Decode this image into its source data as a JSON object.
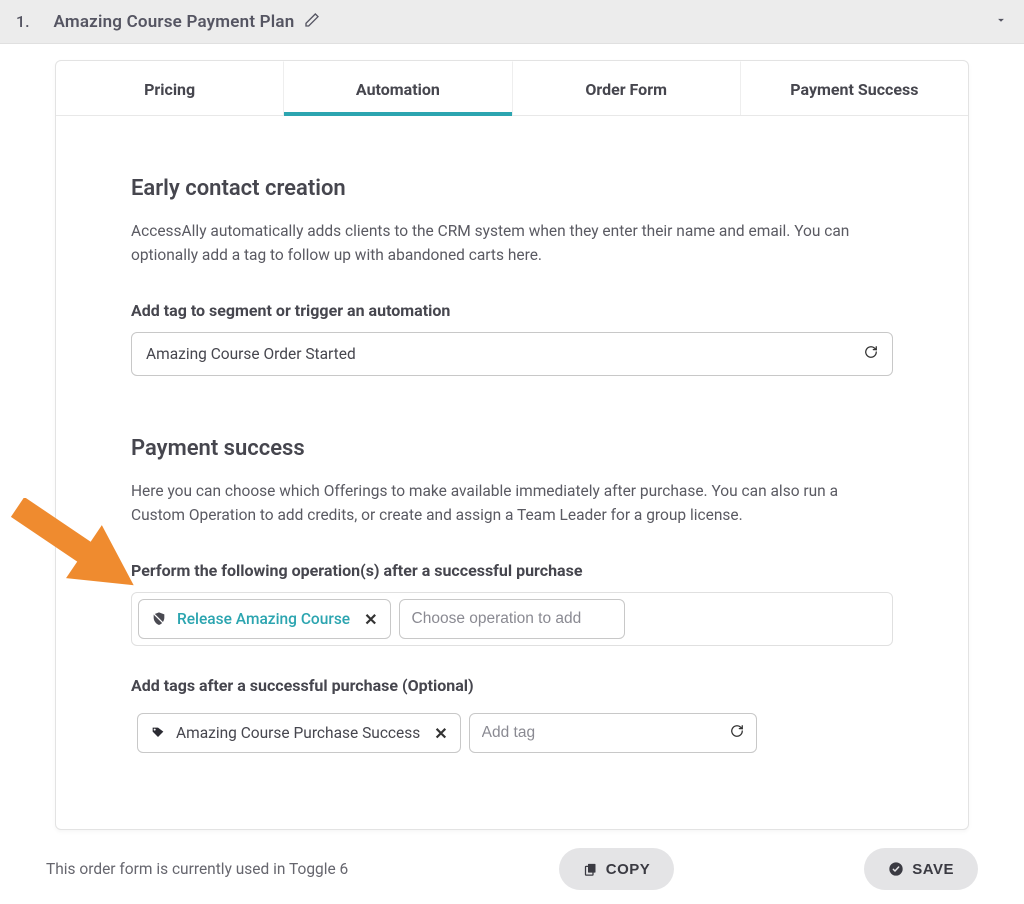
{
  "header": {
    "number": "1.",
    "title": "Amazing Course Payment Plan"
  },
  "tabs": [
    {
      "label": "Pricing",
      "active": false
    },
    {
      "label": "Automation",
      "active": true
    },
    {
      "label": "Order Form",
      "active": false
    },
    {
      "label": "Payment Success",
      "active": false
    }
  ],
  "early_contact": {
    "title": "Early contact creation",
    "desc": "AccessAlly automatically adds clients to the CRM system when they enter their name and email. You can optionally add a tag to follow up with abandoned carts here.",
    "tag_label": "Add tag to segment or trigger an automation",
    "tag_value": "Amazing Course Order Started"
  },
  "payment_success": {
    "title": "Payment success",
    "desc": "Here you can choose which Offerings to make available immediately after purchase. You can also run a Custom Operation to add credits, or create and assign a Team Leader for a group license.",
    "ops_label": "Perform the following operation(s) after a successful purchase",
    "op_chip": "Release Amazing Course",
    "op_placeholder": "Choose operation to add",
    "tags_label": "Add tags after a successful purchase (Optional)",
    "tag_chip": "Amazing Course Purchase Success",
    "tag_placeholder": "Add tag"
  },
  "footer": {
    "text": "This order form is currently used in Toggle 6",
    "copy": "COPY",
    "save": "SAVE"
  }
}
